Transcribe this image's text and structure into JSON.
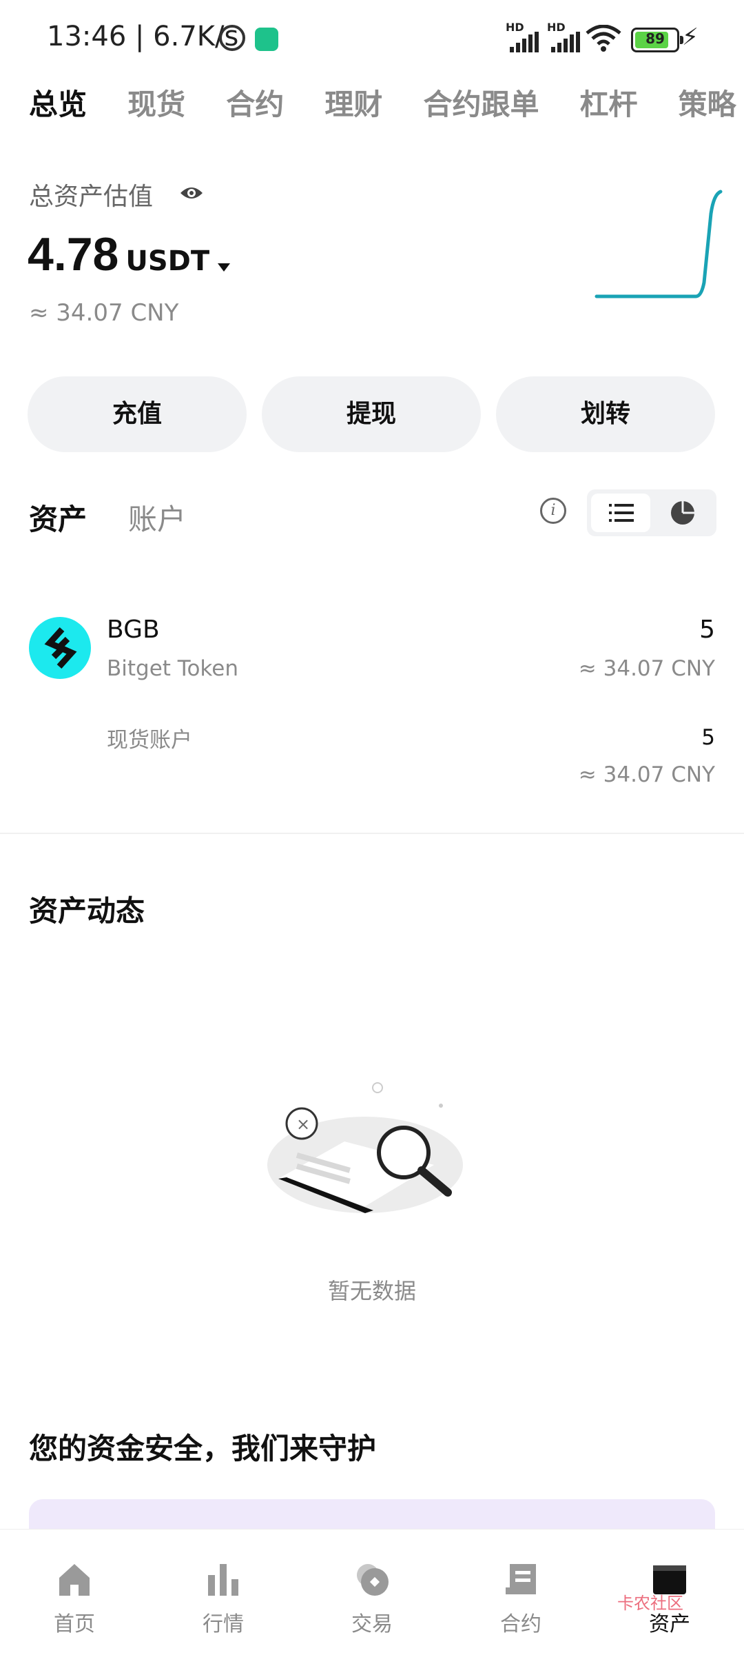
{
  "status_bar": {
    "time": "13:46 | 6.7K/s",
    "signal1_hd": "HD",
    "signal2_hd": "HD",
    "battery": "89"
  },
  "top_tabs": [
    "总览",
    "现货",
    "合约",
    "理财",
    "合约跟单",
    "杠杆",
    "策略"
  ],
  "overview": {
    "label": "总资产估值",
    "total_value": "4.78",
    "unit": "USDT",
    "cny": "≈ 34.07 CNY"
  },
  "actions": {
    "deposit": "充值",
    "withdraw": "提现",
    "transfer": "划转"
  },
  "asset_tabs": {
    "assets": "资产",
    "account": "账户"
  },
  "asset_rows": [
    {
      "symbol": "BGB",
      "name": "Bitget Token",
      "qty": "5",
      "cny": "≈ 34.07 CNY",
      "sub": {
        "label": "现货账户",
        "qty": "5",
        "cny": "≈ 34.07 CNY"
      }
    }
  ],
  "activity": {
    "title": "资产动态",
    "empty": "暂无数据"
  },
  "security": {
    "title": "您的资金安全，我们来守护"
  },
  "bottom_nav": [
    "首页",
    "行情",
    "交易",
    "合约",
    "资产"
  ],
  "watermark": "卡农社区",
  "colors": {
    "accent_cyan": "#1ce9ee",
    "sparkline": "#1aa3b5",
    "button_bg": "#f1f2f4"
  },
  "icons": {
    "status": [
      "alarm-icon",
      "shield-icon",
      "signal-icon",
      "wifi-icon",
      "battery-icon",
      "charging-icon"
    ],
    "nav": [
      "home-icon",
      "market-icon",
      "trade-icon",
      "futures-icon",
      "wallet-icon"
    ]
  }
}
